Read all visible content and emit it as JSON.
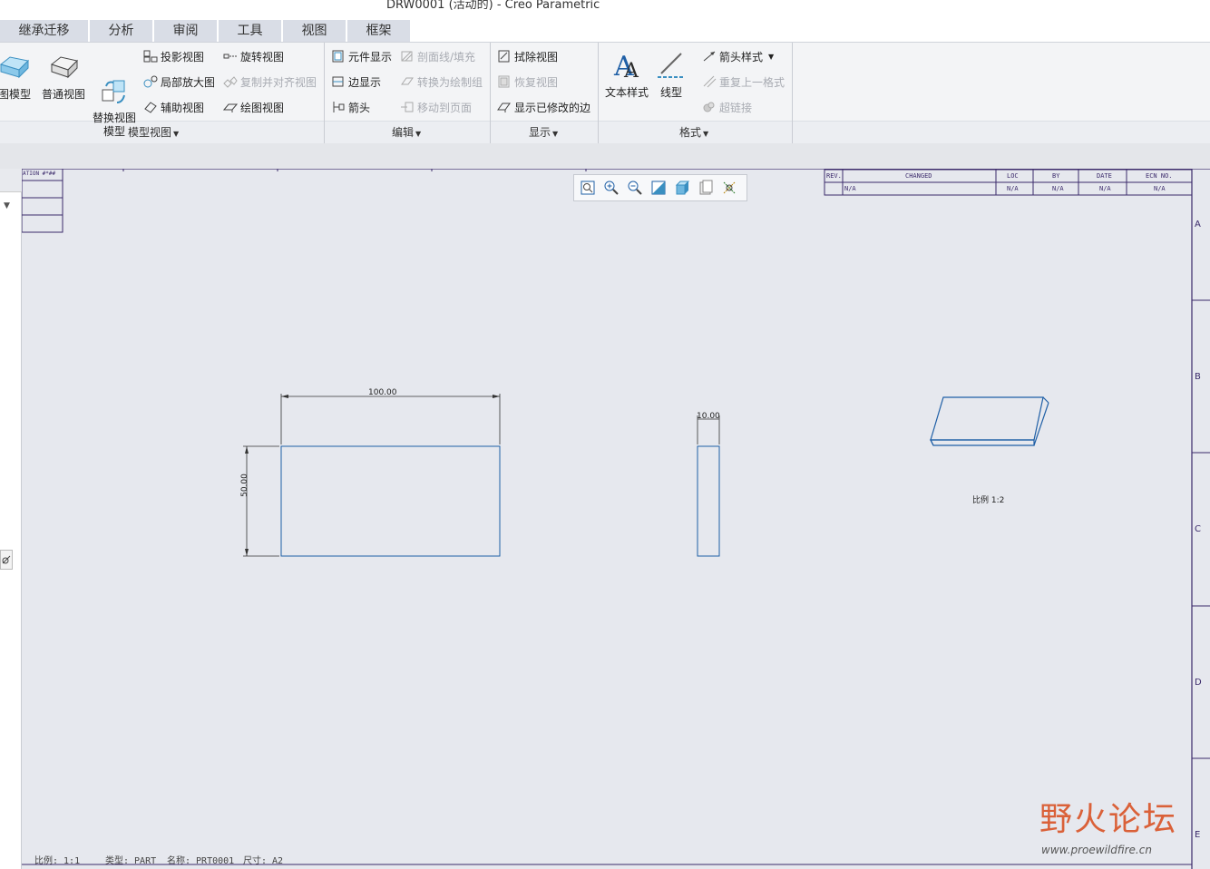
{
  "window": {
    "title": "DRW0001 (活动的) - Creo Parametric"
  },
  "tabs": [
    "继承迁移",
    "分析",
    "审阅",
    "工具",
    "视图",
    "框架"
  ],
  "ribbon": {
    "model_views": {
      "label": "模型视图",
      "big": [
        "图模型",
        "普通视图",
        "替换视图\n模型"
      ],
      "items": [
        "投影视图",
        "局部放大图",
        "辅助视图",
        "旋转视图",
        "复制并对齐视图",
        "绘图视图"
      ]
    },
    "edit": {
      "label": "编辑",
      "items": [
        "元件显示",
        "边显示",
        "箭头",
        "剖面线/填充",
        "转换为绘制组",
        "移动到页面"
      ]
    },
    "display": {
      "label": "显示",
      "items": [
        "拭除视图",
        "恢复视图",
        "显示已修改的边"
      ]
    },
    "format": {
      "label": "格式",
      "big": [
        "文本样式",
        "线型"
      ],
      "items": [
        "箭头样式",
        "重复上一格式",
        "超链接"
      ]
    }
  },
  "revision_table": {
    "headers": [
      "REV.",
      "CHANGED",
      "LOC",
      "BY",
      "DATE",
      "ECN NO."
    ],
    "row": [
      "N/A",
      "",
      "N/A",
      "N/A",
      "N/A",
      "N/A"
    ]
  },
  "top_left_table": {
    "header": "ATION #*##"
  },
  "zone_labels": [
    "A",
    "B",
    "C",
    "D",
    "E"
  ],
  "dimensions": {
    "width": "100.00",
    "height": "50.00",
    "thickness": "10.00"
  },
  "iso_view_scale": "比例 1:2",
  "status_bar": {
    "scale": "比例:  1:1",
    "type": "类型: PART",
    "name": "名称: PRT0001",
    "size": "尺寸: A2"
  },
  "watermark": {
    "brand": "野火论坛",
    "url": "www.proewildfire.cn"
  }
}
